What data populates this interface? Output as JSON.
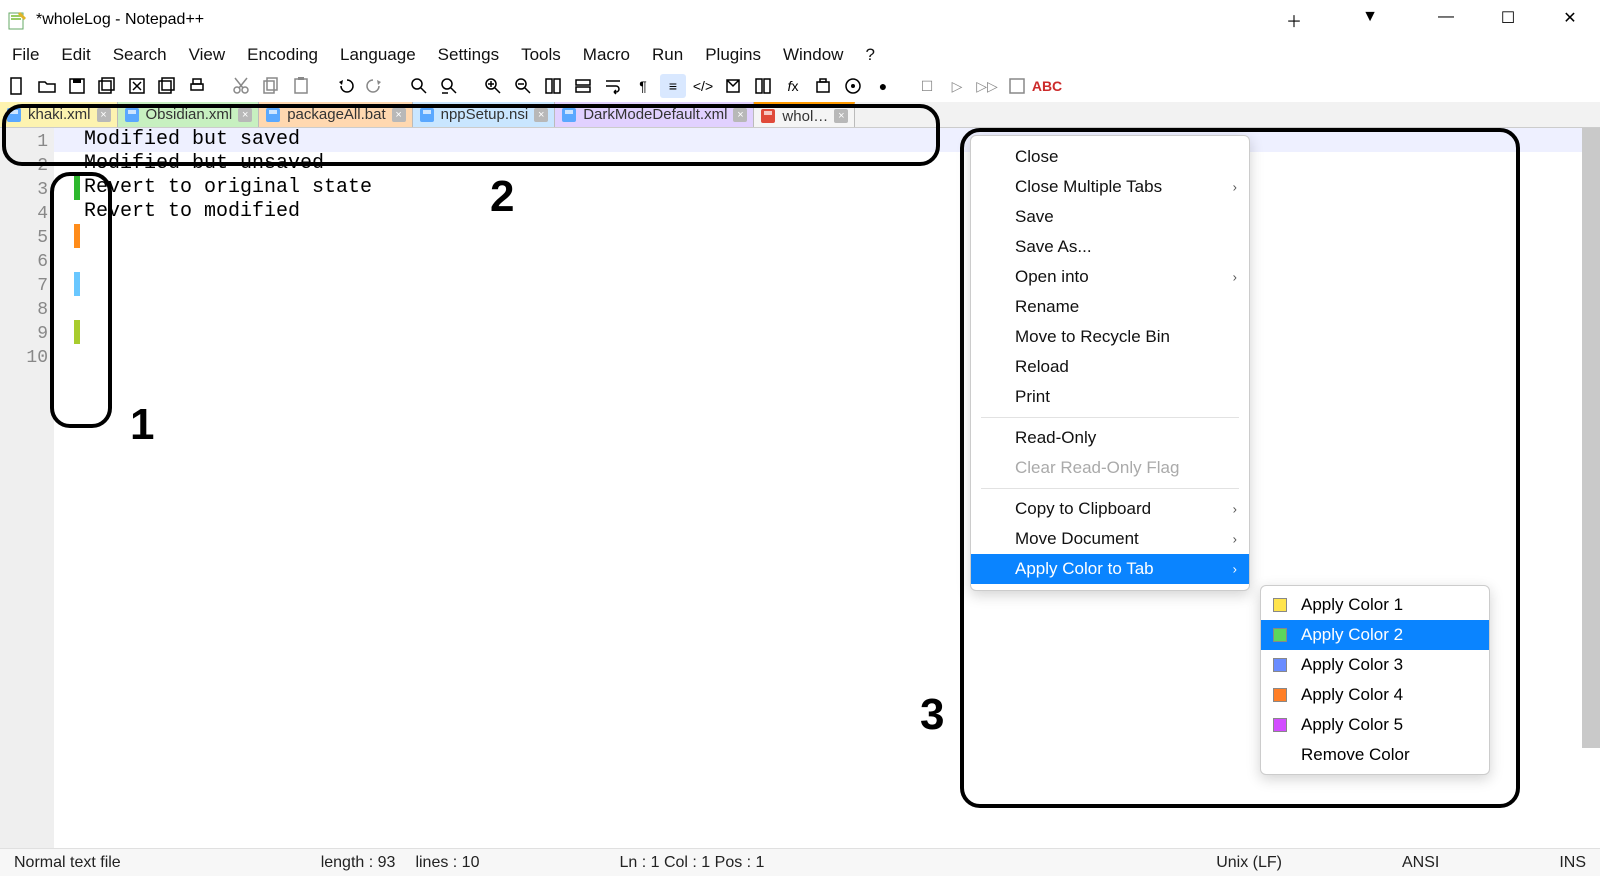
{
  "window": {
    "title": "*wholeLog - Notepad++"
  },
  "menus": [
    "File",
    "Edit",
    "Search",
    "View",
    "Encoding",
    "Language",
    "Settings",
    "Tools",
    "Macro",
    "Run",
    "Plugins",
    "Window",
    "?"
  ],
  "tabs": [
    {
      "label": "khaki.xml",
      "color": "yellow",
      "disk": "#5aa8ff",
      "unsaved": false
    },
    {
      "label": "Obsidian.xml",
      "color": "green",
      "disk": "#5aa8ff",
      "unsaved": false
    },
    {
      "label": "packageAll.bat",
      "color": "orange",
      "disk": "#5aa8ff",
      "unsaved": false
    },
    {
      "label": "nppSetup.nsi",
      "color": "blue",
      "disk": "#5aa8ff",
      "unsaved": false
    },
    {
      "label": "DarkModeDefault.xml",
      "color": "purple",
      "disk": "#5aa8ff",
      "unsaved": false
    },
    {
      "label": "whol…",
      "color": "plain",
      "disk": "#e04a3a",
      "unsaved": true
    }
  ],
  "editor": {
    "lines": [
      {
        "n": 1,
        "text": "",
        "mark": null
      },
      {
        "n": 2,
        "text": "",
        "mark": null
      },
      {
        "n": 3,
        "text": "Modified but saved",
        "mark": "#2eb82e"
      },
      {
        "n": 4,
        "text": "",
        "mark": null
      },
      {
        "n": 5,
        "text": "Modified but unsaved",
        "mark": "#ff8c1a"
      },
      {
        "n": 6,
        "text": "",
        "mark": null
      },
      {
        "n": 7,
        "text": "Revert to original state",
        "mark": "#69c7ff"
      },
      {
        "n": 8,
        "text": "",
        "mark": null
      },
      {
        "n": 9,
        "text": "Revert to modified",
        "mark": "#a8cc2e"
      },
      {
        "n": 10,
        "text": "",
        "mark": null
      }
    ],
    "current_line": 1
  },
  "context_menu": {
    "items": [
      {
        "label": "Close"
      },
      {
        "label": "Close Multiple Tabs",
        "submenu": true
      },
      {
        "label": "Save"
      },
      {
        "label": "Save As..."
      },
      {
        "label": "Open into",
        "submenu": true
      },
      {
        "label": "Rename"
      },
      {
        "label": "Move to Recycle Bin"
      },
      {
        "label": "Reload"
      },
      {
        "label": "Print"
      },
      {
        "sep": true
      },
      {
        "label": "Read-Only"
      },
      {
        "label": "Clear Read-Only Flag",
        "disabled": true
      },
      {
        "sep": true
      },
      {
        "label": "Copy to Clipboard",
        "submenu": true
      },
      {
        "label": "Move Document",
        "submenu": true
      },
      {
        "label": "Apply Color to Tab",
        "submenu": true,
        "highlight": true
      }
    ],
    "color_submenu": [
      {
        "label": "Apply Color 1",
        "swatch": "#ffe44d"
      },
      {
        "label": "Apply Color 2",
        "swatch": "#5cd65c",
        "highlight": true
      },
      {
        "label": "Apply Color 3",
        "swatch": "#6a8cff"
      },
      {
        "label": "Apply Color 4",
        "swatch": "#ff7f27"
      },
      {
        "label": "Apply Color 5",
        "swatch": "#d24dff"
      },
      {
        "label": "Remove Color"
      }
    ]
  },
  "status": {
    "filetype": "Normal text file",
    "length_label": "length : 93",
    "lines_label": "lines : 10",
    "pos_label": "Ln : 1    Col : 1    Pos : 1",
    "eol": "Unix (LF)",
    "encoding": "ANSI",
    "ins": "INS"
  },
  "annotations": {
    "label1": "1",
    "label2": "2",
    "label3": "3"
  }
}
